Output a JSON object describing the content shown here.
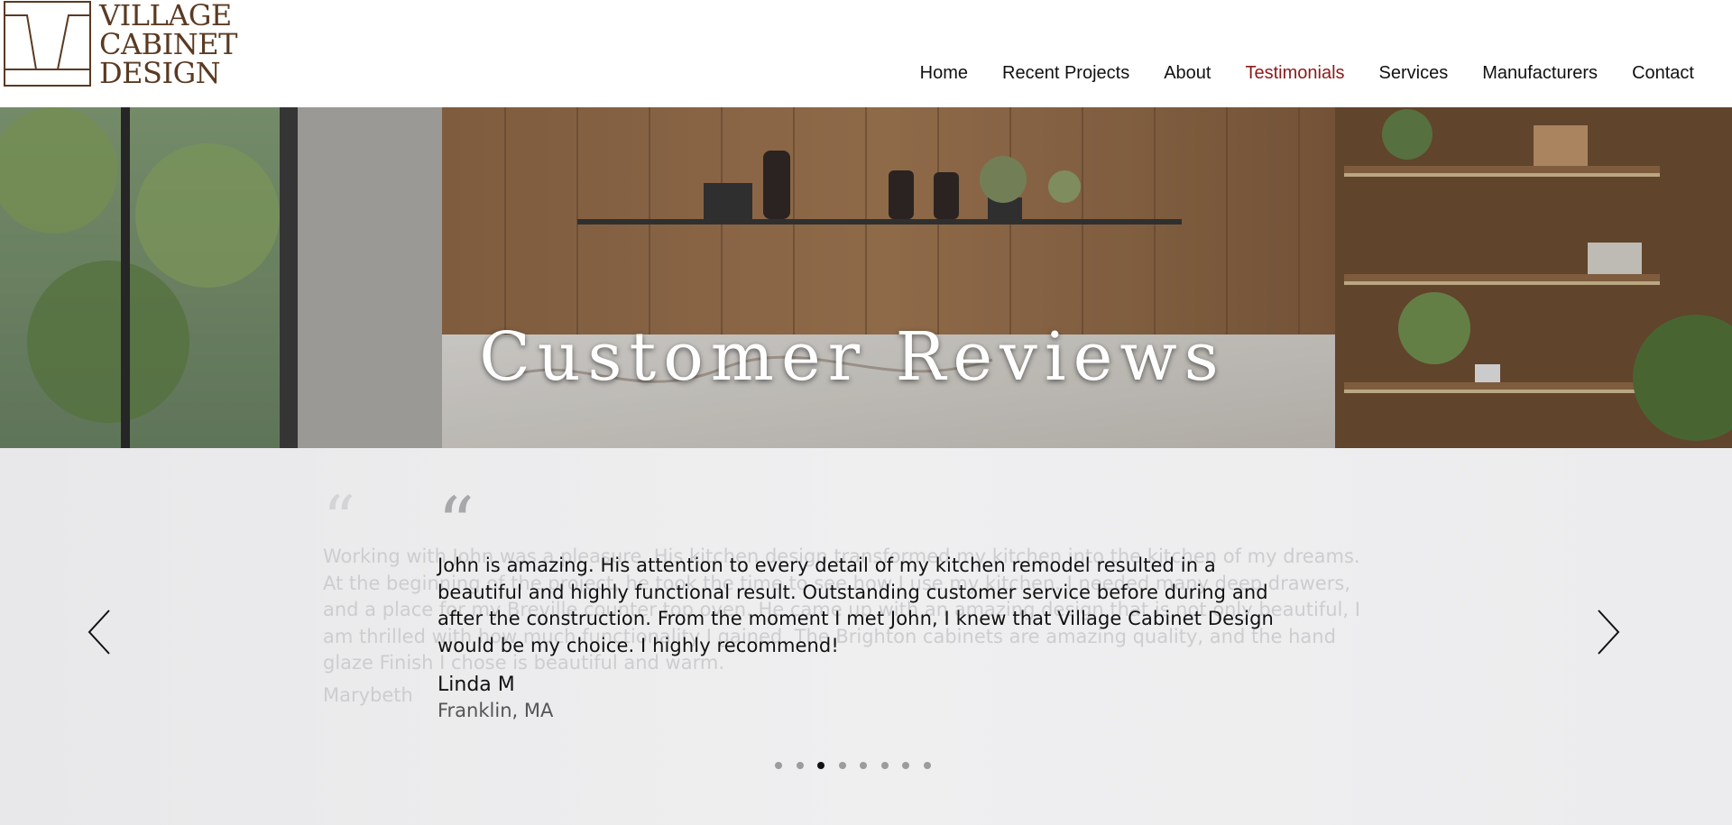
{
  "brand": {
    "name_lines": [
      "VILLAGE",
      "CABINET",
      "DESIGN"
    ],
    "color": "#5a3a22"
  },
  "nav": {
    "items": [
      "Home",
      "Recent Projects",
      "About",
      "Testimonials",
      "Services",
      "Manufacturers",
      "Contact"
    ],
    "active": "Testimonials",
    "active_color": "#8b1a1a"
  },
  "hero": {
    "title": "Customer Reviews"
  },
  "testimonials": {
    "previous": {
      "quote_mark": "“",
      "text": "Working with John was a pleasure. His kitchen design transformed my kitchen into the kitchen of my dreams. At the beginning of the project, he took the time to see how I use my kitchen. I needed many deep drawers, and a place for my Breville counter top oven. He came up with an amazing design that is not only beautiful, I am thrilled with how much functionality I gained. The Brighton cabinets are amazing quality, and the hand glaze Finish I chose is beautiful and warm.",
      "author": "Marybeth"
    },
    "current": {
      "quote_mark": "“",
      "text": "John is amazing. His attention to every detail of my kitchen remodel resulted in a beautiful and highly functional result. Outstanding customer service before during and after the construction. From the moment I met John, I knew that Village Cabinet Design would be my choice. I highly recommend!",
      "author": "Linda M",
      "location": "Franklin, MA"
    },
    "arrows": {
      "prev_icon": "chevron-left-icon",
      "next_icon": "chevron-right-icon"
    },
    "pagination": {
      "count": 8,
      "active_index": 2
    }
  }
}
